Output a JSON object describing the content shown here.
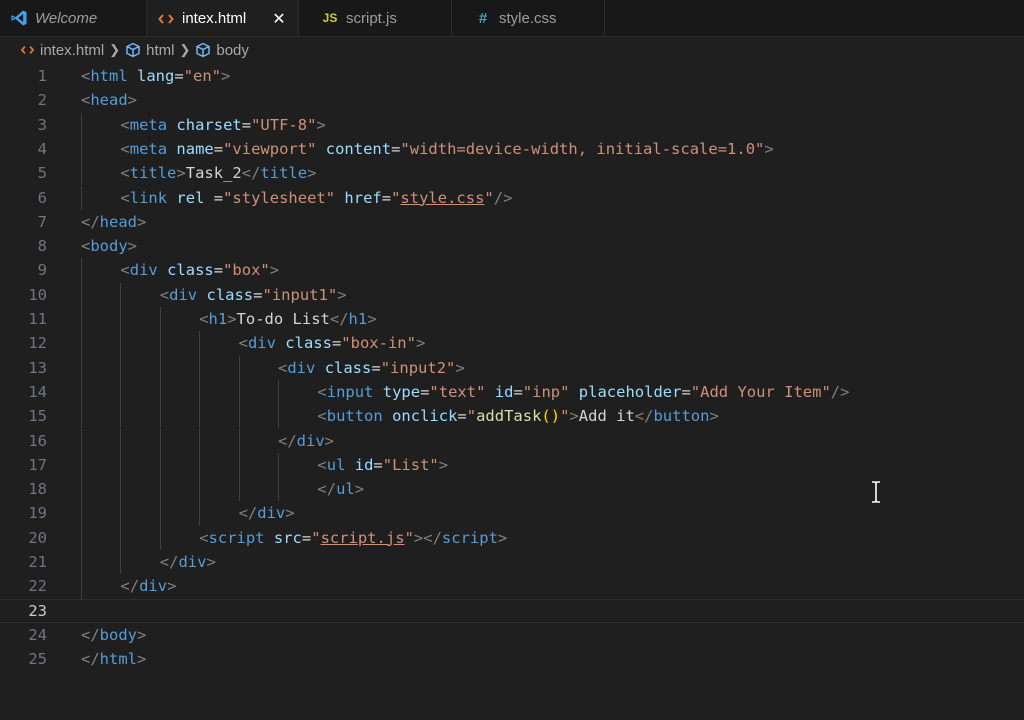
{
  "tabs": [
    {
      "label": "Welcome",
      "icon": "vscode-logo-icon",
      "active": false
    },
    {
      "label": "intex.html",
      "icon": "html-file-icon",
      "active": true,
      "close": "✕"
    },
    {
      "label": "script.js",
      "icon": "js-file-icon",
      "active": false
    },
    {
      "label": "style.css",
      "icon": "css-file-icon",
      "active": false
    }
  ],
  "breadcrumb": [
    "intex.html",
    "html",
    "body"
  ],
  "colors": {
    "tag": "#569cd6",
    "attribute": "#9cdcfe",
    "string": "#ce9178",
    "text": "#d4d4d4",
    "bracket": "#808080",
    "function": "#dcdcaa",
    "paren": "#ffd700"
  },
  "lines": [
    {
      "n": "1",
      "indent": 0,
      "tokens": [
        [
          "br",
          "<"
        ],
        [
          "tag",
          "html"
        ],
        [
          "txt",
          " "
        ],
        [
          "attr",
          "lang"
        ],
        [
          "txt",
          "="
        ],
        [
          "str",
          "\"en\""
        ],
        [
          "br",
          ">"
        ]
      ]
    },
    {
      "n": "2",
      "indent": 0,
      "tokens": [
        [
          "br",
          "<"
        ],
        [
          "tag",
          "head"
        ],
        [
          "br",
          ">"
        ]
      ]
    },
    {
      "n": "3",
      "indent": 1,
      "tokens": [
        [
          "br",
          "<"
        ],
        [
          "tag",
          "meta"
        ],
        [
          "txt",
          " "
        ],
        [
          "attr",
          "charset"
        ],
        [
          "txt",
          "="
        ],
        [
          "str",
          "\"UTF-8\""
        ],
        [
          "br",
          ">"
        ]
      ]
    },
    {
      "n": "4",
      "indent": 1,
      "tokens": [
        [
          "br",
          "<"
        ],
        [
          "tag",
          "meta"
        ],
        [
          "txt",
          " "
        ],
        [
          "attr",
          "name"
        ],
        [
          "txt",
          "="
        ],
        [
          "str",
          "\"viewport\""
        ],
        [
          "txt",
          " "
        ],
        [
          "attr",
          "content"
        ],
        [
          "txt",
          "="
        ],
        [
          "str",
          "\"width=device-width, initial-scale=1.0\""
        ],
        [
          "br",
          ">"
        ]
      ]
    },
    {
      "n": "5",
      "indent": 1,
      "tokens": [
        [
          "br",
          "<"
        ],
        [
          "tag",
          "title"
        ],
        [
          "br",
          ">"
        ],
        [
          "txt",
          "Task_2"
        ],
        [
          "br",
          "</"
        ],
        [
          "tag",
          "title"
        ],
        [
          "br",
          ">"
        ]
      ]
    },
    {
      "n": "6",
      "indent": 1,
      "tokens": [
        [
          "br",
          "<"
        ],
        [
          "tag",
          "link"
        ],
        [
          "txt",
          " "
        ],
        [
          "attr",
          "rel"
        ],
        [
          "txt",
          " ="
        ],
        [
          "str",
          "\"stylesheet\""
        ],
        [
          "txt",
          " "
        ],
        [
          "attr",
          "href"
        ],
        [
          "txt",
          "="
        ],
        [
          "str",
          "\""
        ],
        [
          "strlink",
          "style.css"
        ],
        [
          "str",
          "\""
        ],
        [
          "br",
          "/>"
        ]
      ]
    },
    {
      "n": "7",
      "indent": 0,
      "tokens": [
        [
          "br",
          "</"
        ],
        [
          "tag",
          "head"
        ],
        [
          "br",
          ">"
        ]
      ]
    },
    {
      "n": "8",
      "indent": 0,
      "tokens": [
        [
          "br",
          "<"
        ],
        [
          "tag",
          "body"
        ],
        [
          "br",
          ">"
        ]
      ]
    },
    {
      "n": "9",
      "indent": 1,
      "tokens": [
        [
          "br",
          "<"
        ],
        [
          "tag",
          "div"
        ],
        [
          "txt",
          " "
        ],
        [
          "attr",
          "class"
        ],
        [
          "txt",
          "="
        ],
        [
          "str",
          "\"box\""
        ],
        [
          "br",
          ">"
        ]
      ]
    },
    {
      "n": "10",
      "indent": 2,
      "tokens": [
        [
          "br",
          "<"
        ],
        [
          "tag",
          "div"
        ],
        [
          "txt",
          " "
        ],
        [
          "attr",
          "class"
        ],
        [
          "txt",
          "="
        ],
        [
          "str",
          "\"input1\""
        ],
        [
          "br",
          ">"
        ]
      ]
    },
    {
      "n": "11",
      "indent": 3,
      "tokens": [
        [
          "br",
          "<"
        ],
        [
          "tag",
          "h1"
        ],
        [
          "br",
          ">"
        ],
        [
          "txt",
          "To-do List"
        ],
        [
          "br",
          "</"
        ],
        [
          "tag",
          "h1"
        ],
        [
          "br",
          ">"
        ]
      ]
    },
    {
      "n": "12",
      "indent": 4,
      "tokens": [
        [
          "br",
          "<"
        ],
        [
          "tag",
          "div"
        ],
        [
          "txt",
          " "
        ],
        [
          "attr",
          "class"
        ],
        [
          "txt",
          "="
        ],
        [
          "str",
          "\"box-in\""
        ],
        [
          "br",
          ">"
        ]
      ]
    },
    {
      "n": "13",
      "indent": 5,
      "tokens": [
        [
          "br",
          "<"
        ],
        [
          "tag",
          "div"
        ],
        [
          "txt",
          " "
        ],
        [
          "attr",
          "class"
        ],
        [
          "txt",
          "="
        ],
        [
          "str",
          "\"input2\""
        ],
        [
          "br",
          ">"
        ]
      ]
    },
    {
      "n": "14",
      "indent": 6,
      "tokens": [
        [
          "br",
          "<"
        ],
        [
          "tag",
          "input"
        ],
        [
          "txt",
          " "
        ],
        [
          "attr",
          "type"
        ],
        [
          "txt",
          "="
        ],
        [
          "str",
          "\"text\""
        ],
        [
          "txt",
          " "
        ],
        [
          "attr",
          "id"
        ],
        [
          "txt",
          "="
        ],
        [
          "str",
          "\"inp\""
        ],
        [
          "txt",
          " "
        ],
        [
          "attr",
          "placeholder"
        ],
        [
          "txt",
          "="
        ],
        [
          "str",
          "\"Add Your Item\""
        ],
        [
          "br",
          "/>"
        ]
      ]
    },
    {
      "n": "15",
      "indent": 6,
      "tokens": [
        [
          "br",
          "<"
        ],
        [
          "tag",
          "button"
        ],
        [
          "txt",
          " "
        ],
        [
          "attr",
          "onclick"
        ],
        [
          "txt",
          "="
        ],
        [
          "str",
          "\""
        ],
        [
          "fn",
          "addTask"
        ],
        [
          "paren",
          "()"
        ],
        [
          "str",
          "\""
        ],
        [
          "br",
          ">"
        ],
        [
          "txt",
          "Add it"
        ],
        [
          "br",
          "</"
        ],
        [
          "tag",
          "button"
        ],
        [
          "br",
          ">"
        ]
      ]
    },
    {
      "n": "16",
      "indent": 5,
      "tokens": [
        [
          "br",
          "</"
        ],
        [
          "tag",
          "div"
        ],
        [
          "br",
          ">"
        ]
      ]
    },
    {
      "n": "17",
      "indent": 6,
      "tokens": [
        [
          "br",
          "<"
        ],
        [
          "tag",
          "ul"
        ],
        [
          "txt",
          " "
        ],
        [
          "attr",
          "id"
        ],
        [
          "txt",
          "="
        ],
        [
          "str",
          "\"List\""
        ],
        [
          "br",
          ">"
        ]
      ]
    },
    {
      "n": "18",
      "indent": 6,
      "tokens": [
        [
          "br",
          "</"
        ],
        [
          "tag",
          "ul"
        ],
        [
          "br",
          ">"
        ]
      ]
    },
    {
      "n": "19",
      "indent": 4,
      "tokens": [
        [
          "br",
          "</"
        ],
        [
          "tag",
          "div"
        ],
        [
          "br",
          ">"
        ]
      ]
    },
    {
      "n": "20",
      "indent": 3,
      "tokens": [
        [
          "br",
          "<"
        ],
        [
          "tag",
          "script"
        ],
        [
          "txt",
          " "
        ],
        [
          "attr",
          "src"
        ],
        [
          "txt",
          "="
        ],
        [
          "str",
          "\""
        ],
        [
          "strlink",
          "script.js"
        ],
        [
          "str",
          "\""
        ],
        [
          "br",
          "></"
        ],
        [
          "tag",
          "script"
        ],
        [
          "br",
          ">"
        ]
      ]
    },
    {
      "n": "21",
      "indent": 2,
      "tokens": [
        [
          "br",
          "</"
        ],
        [
          "tag",
          "div"
        ],
        [
          "br",
          ">"
        ]
      ]
    },
    {
      "n": "22",
      "indent": 1,
      "tokens": [
        [
          "br",
          "</"
        ],
        [
          "tag",
          "div"
        ],
        [
          "br",
          ">"
        ]
      ]
    },
    {
      "n": "23",
      "indent": 0,
      "tokens": [],
      "current": true
    },
    {
      "n": "24",
      "indent": 0,
      "tokens": [
        [
          "br",
          "</"
        ],
        [
          "tag",
          "body"
        ],
        [
          "br",
          ">"
        ]
      ]
    },
    {
      "n": "25",
      "indent": 0,
      "tokens": [
        [
          "br",
          "</"
        ],
        [
          "tag",
          "html"
        ],
        [
          "br",
          ">"
        ]
      ]
    }
  ]
}
